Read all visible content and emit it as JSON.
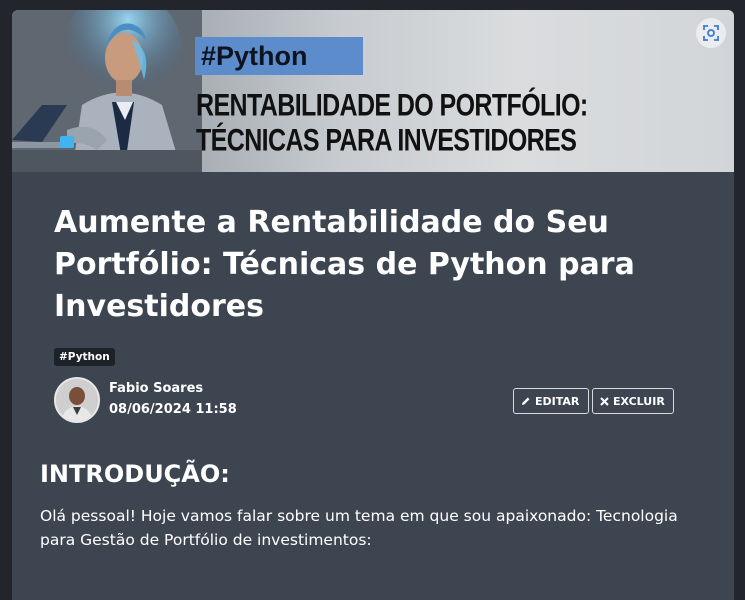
{
  "banner": {
    "tag": "#Python",
    "line1": "RENTABILIDADE DO PORTFÓLIO:",
    "line2": "TÉCNICAS PARA INVESTIDORES"
  },
  "post": {
    "title": "Aumente a Rentabilidade do Seu Portfólio: Técnicas de Python para Investidores",
    "tag": "#Python",
    "author": "Fabio Soares",
    "date": "08/06/2024 11:58"
  },
  "actions": {
    "edit_label": "EDITAR",
    "delete_label": "EXCLUIR"
  },
  "content": {
    "heading": "INTRODUÇÃO:",
    "paragraph": "Olá pessoal! Hoje vamos falar sobre um tema em que sou apaixonado: Tecnologia para Gestão de Portfólio de investimentos:"
  },
  "colors": {
    "page_bg": "#22252b",
    "card_bg": "#3d4551",
    "tag_highlight": "#5d8ccc"
  },
  "icons": [
    "scan-icon",
    "pencil-icon",
    "close-icon"
  ]
}
